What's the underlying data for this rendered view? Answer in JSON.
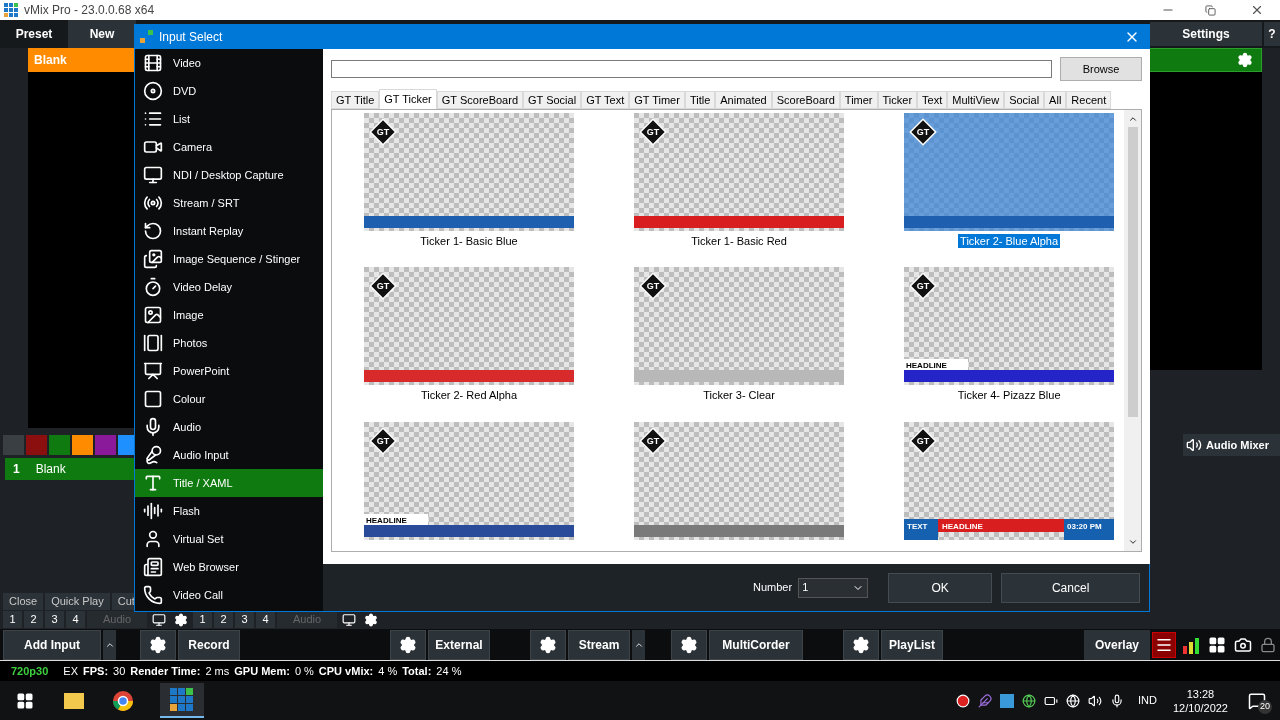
{
  "window": {
    "title": "vMix Pro - 23.0.0.68 x64"
  },
  "top_bar": {
    "tabs": [
      {
        "label": "Preset",
        "selected": true
      },
      {
        "label": "New",
        "selected": false
      }
    ],
    "settings": "Settings",
    "help": "?"
  },
  "preview": {
    "header": "Blank"
  },
  "color_swatches": [
    {
      "color": "#3a3f44"
    },
    {
      "color": "#8b0f0f"
    },
    {
      "color": "#0f7a0f"
    },
    {
      "color": "#ff8c00"
    },
    {
      "color": "#8a1a9a"
    },
    {
      "color": "#1e90ff"
    }
  ],
  "audio_mixer": "Audio Mixer",
  "inputs": [
    {
      "number": "1",
      "name": "Blank",
      "selected": true
    }
  ],
  "input_actions": [
    "Close",
    "Quick Play",
    "Cut"
  ],
  "overlay_rows": [
    {
      "numbers": [
        "1",
        "2",
        "3",
        "4"
      ],
      "audio": "Audio"
    },
    {
      "numbers": [
        "1",
        "2",
        "3",
        "4"
      ],
      "audio": "Audio"
    }
  ],
  "bottom_buttons": [
    {
      "label": "Add Input",
      "settings_button": false,
      "caret": true
    },
    {
      "label": "Record",
      "settings_button": true,
      "caret": false
    },
    {
      "label": "External",
      "settings_button": true,
      "caret": false
    },
    {
      "label": "Stream",
      "settings_button": true,
      "caret": true
    },
    {
      "label": "MultiCorder",
      "settings_button": true,
      "caret": false
    },
    {
      "label": "PlayList",
      "settings_button": true,
      "caret": false
    }
  ],
  "overlay_button": "Overlay",
  "status_bar": {
    "format": "720p30",
    "mode": "EX",
    "stats": [
      {
        "label": "FPS:",
        "value": "30"
      },
      {
        "label": "Render Time:",
        "value": "2 ms"
      },
      {
        "label": "GPU Mem:",
        "value": "0 %"
      },
      {
        "label": "CPU vMix:",
        "value": "4 %"
      },
      {
        "label": "Total:",
        "value": "24 %"
      }
    ]
  },
  "dialog": {
    "title": "Input Select",
    "input_types": [
      {
        "label": "Video",
        "selected": false
      },
      {
        "label": "DVD",
        "selected": false
      },
      {
        "label": "List",
        "selected": false
      },
      {
        "label": "Camera",
        "selected": false
      },
      {
        "label": "NDI / Desktop Capture",
        "selected": false
      },
      {
        "label": "Stream / SRT",
        "selected": false
      },
      {
        "label": "Instant Replay",
        "selected": false
      },
      {
        "label": "Image Sequence / Stinger",
        "selected": false
      },
      {
        "label": "Video Delay",
        "selected": false
      },
      {
        "label": "Image",
        "selected": false
      },
      {
        "label": "Photos",
        "selected": false
      },
      {
        "label": "PowerPoint",
        "selected": false
      },
      {
        "label": "Colour",
        "selected": false
      },
      {
        "label": "Audio",
        "selected": false
      },
      {
        "label": "Audio Input",
        "selected": false
      },
      {
        "label": "Title / XAML",
        "selected": true
      },
      {
        "label": "Flash",
        "selected": false
      },
      {
        "label": "Virtual Set",
        "selected": false
      },
      {
        "label": "Web Browser",
        "selected": false
      },
      {
        "label": "Video Call",
        "selected": false
      }
    ],
    "browse": "Browse",
    "tabs": [
      {
        "label": "GT Title",
        "selected": false
      },
      {
        "label": "GT Ticker",
        "selected": true
      },
      {
        "label": "GT ScoreBoard",
        "selected": false
      },
      {
        "label": "GT Social",
        "selected": false
      },
      {
        "label": "GT Text",
        "selected": false
      },
      {
        "label": "GT Timer",
        "selected": false
      },
      {
        "label": "Title",
        "selected": false
      },
      {
        "label": "Animated",
        "selected": false
      },
      {
        "label": "ScoreBoard",
        "selected": false
      },
      {
        "label": "Timer",
        "selected": false
      },
      {
        "label": "Ticker",
        "selected": false
      },
      {
        "label": "Text",
        "selected": false
      },
      {
        "label": "MultiView",
        "selected": false
      },
      {
        "label": "Social",
        "selected": false
      },
      {
        "label": "All",
        "selected": false
      },
      {
        "label": "Recent",
        "selected": false
      }
    ],
    "templates": [
      {
        "label": "Ticker 1- Basic Blue",
        "selected": false,
        "badge": "GT",
        "color": "#1f5fb0"
      },
      {
        "label": "Ticker 1- Basic Red",
        "selected": false,
        "badge": "GT",
        "color": "#d81e1e"
      },
      {
        "label": "Ticker 2- Blue Alpha",
        "selected": true,
        "badge": "GT",
        "color": "#1f5fb0"
      },
      {
        "label": "Ticker 2- Red Alpha",
        "selected": false,
        "badge": "GT",
        "color": "#d82a2a"
      },
      {
        "label": "Ticker 3- Clear",
        "selected": false,
        "badge": "GT",
        "color": "#b8b8b8"
      },
      {
        "label": "Ticker 4- Pizazz Blue",
        "selected": false,
        "badge": "GT",
        "color": "#2424c8",
        "headline": "HEADLINE"
      },
      {
        "badge": "GT",
        "selected": false,
        "color": "#2a4a9a",
        "headline": "HEADLINE"
      },
      {
        "badge": "GT",
        "selected": false,
        "color": "#7a7a7a"
      },
      {
        "badge": "GT",
        "selected": false,
        "color": "#d81e1e",
        "headline": "HEADLINE",
        "tag": "TEXT",
        "time": "03:20 PM"
      }
    ],
    "number_label": "Number",
    "number_value": "1",
    "ok": "OK",
    "cancel": "Cancel"
  },
  "taskbar": {
    "language": "IND",
    "time": "13:28",
    "date": "12/10/2022",
    "notifications": "20"
  }
}
